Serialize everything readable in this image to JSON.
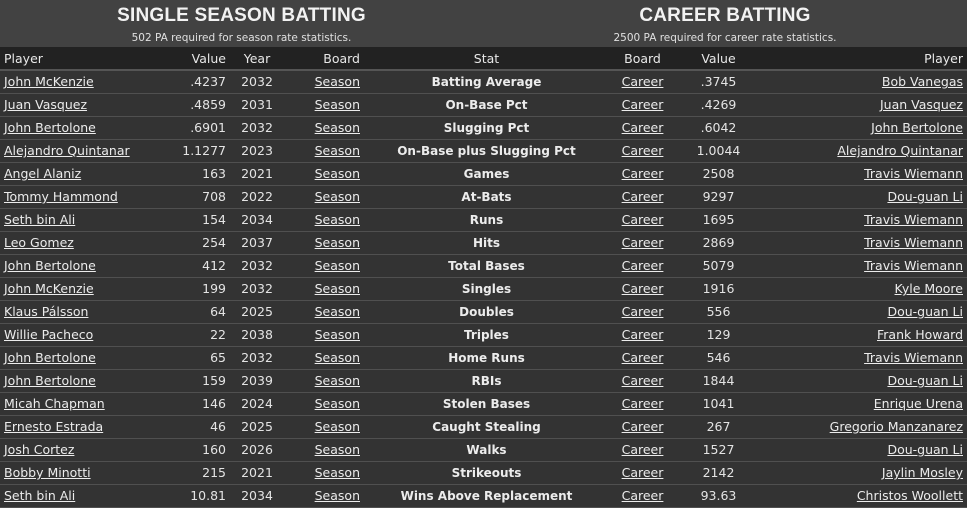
{
  "season": {
    "title": "SINGLE SEASON BATTING",
    "subtitle": "502 PA required for season rate statistics."
  },
  "career": {
    "title": "CAREER BATTING",
    "subtitle": "2500 PA required for career rate statistics."
  },
  "columns": {
    "season_player": "Player",
    "season_value": "Value",
    "season_year": "Year",
    "season_board": "Board",
    "stat": "Stat",
    "career_board": "Board",
    "career_value": "Value",
    "career_player": "Player"
  },
  "rows": [
    {
      "s_player": "John McKenzie",
      "s_value": ".4237",
      "s_year": "2032",
      "s_board": "Season",
      "stat": "Batting Average",
      "c_board": "Career",
      "c_value": ".3745",
      "c_player": "Bob Vanegas"
    },
    {
      "s_player": "Juan Vasquez",
      "s_value": ".4859",
      "s_year": "2031",
      "s_board": "Season",
      "stat": "On-Base Pct",
      "c_board": "Career",
      "c_value": ".4269",
      "c_player": "Juan Vasquez"
    },
    {
      "s_player": "John Bertolone",
      "s_value": ".6901",
      "s_year": "2032",
      "s_board": "Season",
      "stat": "Slugging Pct",
      "c_board": "Career",
      "c_value": ".6042",
      "c_player": "John Bertolone"
    },
    {
      "s_player": "Alejandro Quintanar",
      "s_value": "1.1277",
      "s_year": "2023",
      "s_board": "Season",
      "stat": "On-Base plus Slugging Pct",
      "c_board": "Career",
      "c_value": "1.0044",
      "c_player": "Alejandro Quintanar"
    },
    {
      "s_player": "Angel Alaniz",
      "s_value": "163",
      "s_year": "2021",
      "s_board": "Season",
      "stat": "Games",
      "c_board": "Career",
      "c_value": "2508",
      "c_player": "Travis Wiemann"
    },
    {
      "s_player": "Tommy Hammond",
      "s_value": "708",
      "s_year": "2022",
      "s_board": "Season",
      "stat": "At-Bats",
      "c_board": "Career",
      "c_value": "9297",
      "c_player": "Dou-guan Li"
    },
    {
      "s_player": "Seth bin Ali",
      "s_value": "154",
      "s_year": "2034",
      "s_board": "Season",
      "stat": "Runs",
      "c_board": "Career",
      "c_value": "1695",
      "c_player": "Travis Wiemann"
    },
    {
      "s_player": "Leo Gomez",
      "s_value": "254",
      "s_year": "2037",
      "s_board": "Season",
      "stat": "Hits",
      "c_board": "Career",
      "c_value": "2869",
      "c_player": "Travis Wiemann"
    },
    {
      "s_player": "John Bertolone",
      "s_value": "412",
      "s_year": "2032",
      "s_board": "Season",
      "stat": "Total Bases",
      "c_board": "Career",
      "c_value": "5079",
      "c_player": "Travis Wiemann"
    },
    {
      "s_player": "John McKenzie",
      "s_value": "199",
      "s_year": "2032",
      "s_board": "Season",
      "stat": "Singles",
      "c_board": "Career",
      "c_value": "1916",
      "c_player": "Kyle Moore"
    },
    {
      "s_player": "Klaus Pálsson",
      "s_value": "64",
      "s_year": "2025",
      "s_board": "Season",
      "stat": "Doubles",
      "c_board": "Career",
      "c_value": "556",
      "c_player": "Dou-guan Li"
    },
    {
      "s_player": "Willie Pacheco",
      "s_value": "22",
      "s_year": "2038",
      "s_board": "Season",
      "stat": "Triples",
      "c_board": "Career",
      "c_value": "129",
      "c_player": "Frank Howard"
    },
    {
      "s_player": "John Bertolone",
      "s_value": "65",
      "s_year": "2032",
      "s_board": "Season",
      "stat": "Home Runs",
      "c_board": "Career",
      "c_value": "546",
      "c_player": "Travis Wiemann"
    },
    {
      "s_player": "John Bertolone",
      "s_value": "159",
      "s_year": "2039",
      "s_board": "Season",
      "stat": "RBIs",
      "c_board": "Career",
      "c_value": "1844",
      "c_player": "Dou-guan Li"
    },
    {
      "s_player": "Micah Chapman",
      "s_value": "146",
      "s_year": "2024",
      "s_board": "Season",
      "stat": "Stolen Bases",
      "c_board": "Career",
      "c_value": "1041",
      "c_player": "Enrique Urena"
    },
    {
      "s_player": "Ernesto Estrada",
      "s_value": "46",
      "s_year": "2025",
      "s_board": "Season",
      "stat": "Caught Stealing",
      "c_board": "Career",
      "c_value": "267",
      "c_player": "Gregorio Manzanarez"
    },
    {
      "s_player": "Josh Cortez",
      "s_value": "160",
      "s_year": "2026",
      "s_board": "Season",
      "stat": "Walks",
      "c_board": "Career",
      "c_value": "1527",
      "c_player": "Dou-guan Li"
    },
    {
      "s_player": "Bobby Minotti",
      "s_value": "215",
      "s_year": "2021",
      "s_board": "Season",
      "stat": "Strikeouts",
      "c_board": "Career",
      "c_value": "2142",
      "c_player": "Jaylin Mosley"
    },
    {
      "s_player": "Seth bin Ali",
      "s_value": "10.81",
      "s_year": "2034",
      "s_board": "Season",
      "stat": "Wins Above Replacement",
      "c_board": "Career",
      "c_value": "93.63",
      "c_player": "Christos Woollett"
    }
  ]
}
